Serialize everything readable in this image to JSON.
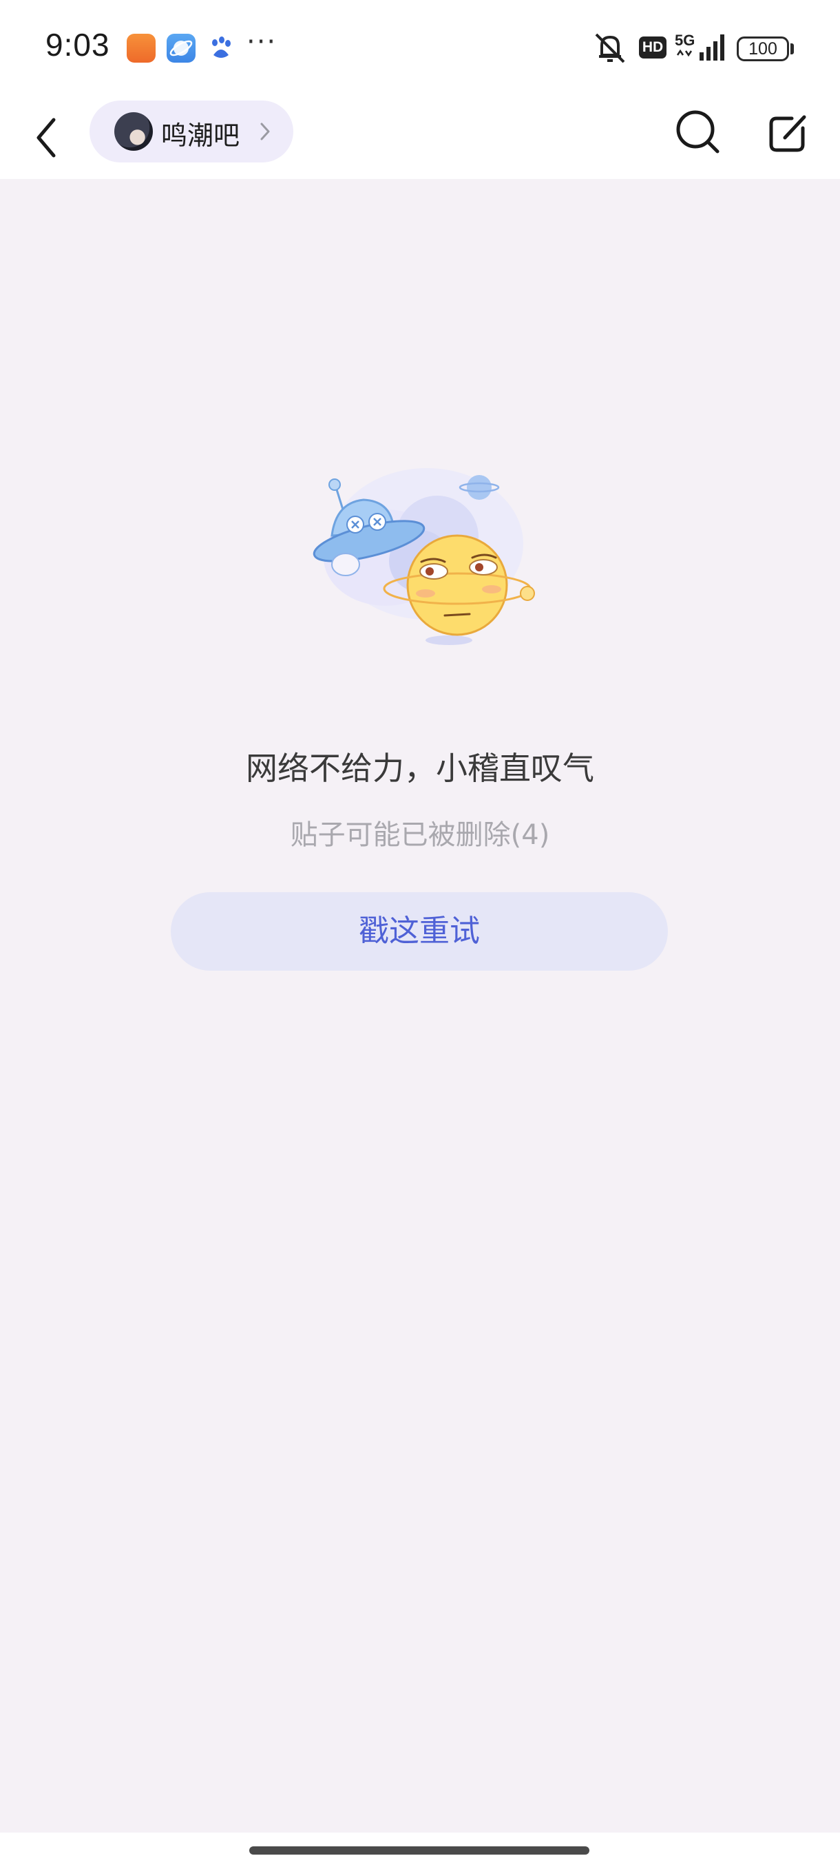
{
  "status_bar": {
    "time": "9:03",
    "notifications": [
      "shop-app-icon",
      "browser-planet-icon",
      "baidu-paw-icon"
    ],
    "more": "···",
    "network_badge": "HD",
    "network_type": "5G",
    "battery": "100"
  },
  "nav": {
    "forum_name": "鸣潮吧",
    "icons": [
      "back-arrow-icon",
      "chevron-right-icon",
      "search-icon",
      "edit-icon"
    ]
  },
  "error": {
    "title": "网络不给力，小稽直叹气",
    "subtitle": "贴子可能已被删除(4)",
    "retry_label": "戳这重试"
  },
  "colors": {
    "background": "#f5f1f6",
    "accent": "#4f61d6",
    "button_bg": "#e5e6f7"
  }
}
